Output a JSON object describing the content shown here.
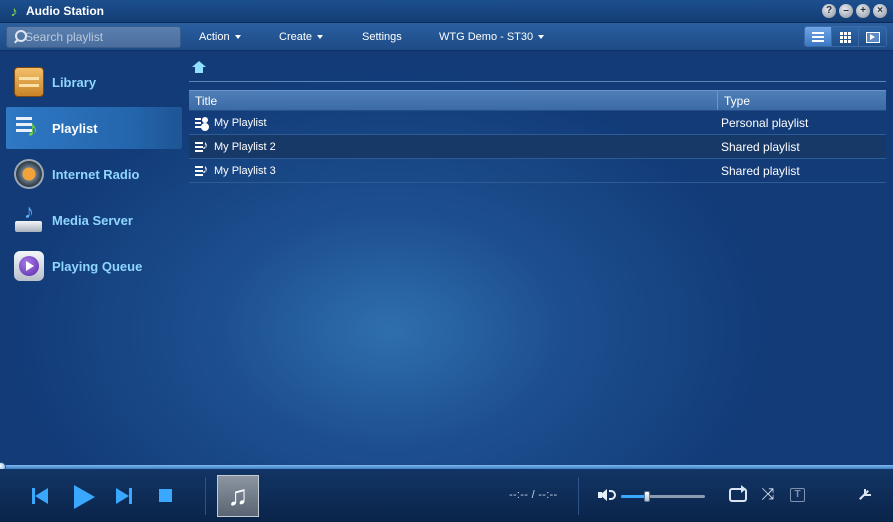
{
  "window": {
    "title": "Audio Station",
    "app_icon": "music-note-icon",
    "controls": [
      "help-icon",
      "minimize-icon",
      "maximize-icon",
      "close-icon"
    ],
    "control_glyphs": [
      "?",
      "–",
      "+",
      "×"
    ]
  },
  "toolbar": {
    "search": {
      "placeholder": "Search playlist",
      "value": ""
    },
    "menus": [
      {
        "label": "Action",
        "has_dropdown": true
      },
      {
        "label": "Create",
        "has_dropdown": true
      },
      {
        "label": "Settings",
        "has_dropdown": false
      },
      {
        "label": "WTG Demo - ST30",
        "has_dropdown": true
      }
    ],
    "view_modes": [
      "list-view-icon",
      "thumbnail-view-icon",
      "cover-flow-icon"
    ],
    "active_view": "list"
  },
  "sidebar": {
    "items": [
      {
        "label": "Library",
        "icon": "library-icon",
        "active": false
      },
      {
        "label": "Playlist",
        "icon": "playlist-icon",
        "active": true
      },
      {
        "label": "Internet Radio",
        "icon": "internet-radio-icon",
        "active": false
      },
      {
        "label": "Media Server",
        "icon": "media-server-icon",
        "active": false
      },
      {
        "label": "Playing Queue",
        "icon": "playing-queue-icon",
        "active": false
      }
    ]
  },
  "content": {
    "breadcrumb_icon": "home-icon",
    "table": {
      "columns": [
        "Title",
        "Type"
      ],
      "rows": [
        {
          "title": "My Playlist",
          "type": "Personal playlist",
          "icon": "personal-playlist-icon",
          "selected": false
        },
        {
          "title": "My Playlist 2",
          "type": "Shared playlist",
          "icon": "shared-playlist-icon",
          "selected": true
        },
        {
          "title": "My Playlist 3",
          "type": "Shared playlist",
          "icon": "shared-playlist-icon",
          "selected": false
        }
      ]
    }
  },
  "player": {
    "time": "--:-- / --:--",
    "progress": 0,
    "volume": 0.31,
    "cover_glyph": "♫",
    "shuffle_glyph": "⤨",
    "lyrics_glyph": "T",
    "colors": {
      "accent": "#3aa8ff",
      "selected_row": "#173968",
      "nav_text": "#8fd6ff"
    }
  }
}
